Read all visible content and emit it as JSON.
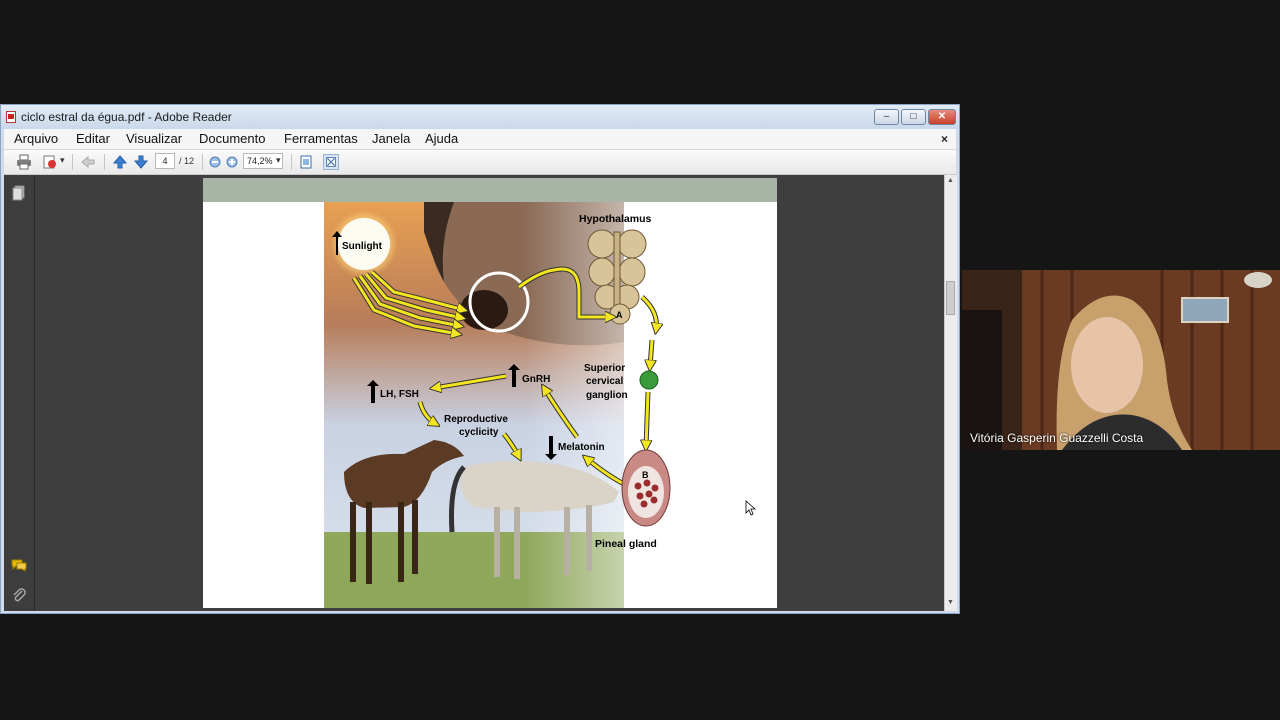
{
  "window": {
    "title": "ciclo estral da égua.pdf - Adobe Reader",
    "controls": {
      "minimize": "–",
      "maximize": "□",
      "close": "✕"
    }
  },
  "menu": {
    "items": [
      "Arquivo",
      "Editar",
      "Visualizar",
      "Documento",
      "Ferramentas",
      "Janela",
      "Ajuda"
    ],
    "close": "×"
  },
  "toolbar": {
    "current_page": "4",
    "total_pages": "/ 12",
    "zoom": "74,2%",
    "icons": [
      "print-icon",
      "export-icon",
      "back-icon",
      "previous-page-icon",
      "next-page-icon",
      "zoom-out-icon",
      "zoom-in-icon",
      "fit-page-icon",
      "fullscreen-icon"
    ]
  },
  "left_panel": {
    "icons": [
      "pages-icon",
      "comments-icon",
      "attachments-icon"
    ]
  },
  "figure": {
    "labels": {
      "sunlight": "Sunlight",
      "hypothalamus": "Hypothalamus",
      "gnrh": "GnRH",
      "lh_fsh": "LH, FSH",
      "reproductive": "Reproductive",
      "cyclicity": "cyclicity",
      "superior": "Superior",
      "cervical": "cervical",
      "ganglion": "ganglion",
      "melatonin": "Melatonin",
      "pineal": "Pineal gland",
      "label_a": "A",
      "label_b": "B"
    }
  },
  "video": {
    "participant_name": "Vitória Gasperin Guazzelli Costa"
  },
  "colors": {
    "arrow_yellow": "#f3e51f",
    "titlebar": "#cfdbe8",
    "document_bg": "#3e3e3e"
  }
}
